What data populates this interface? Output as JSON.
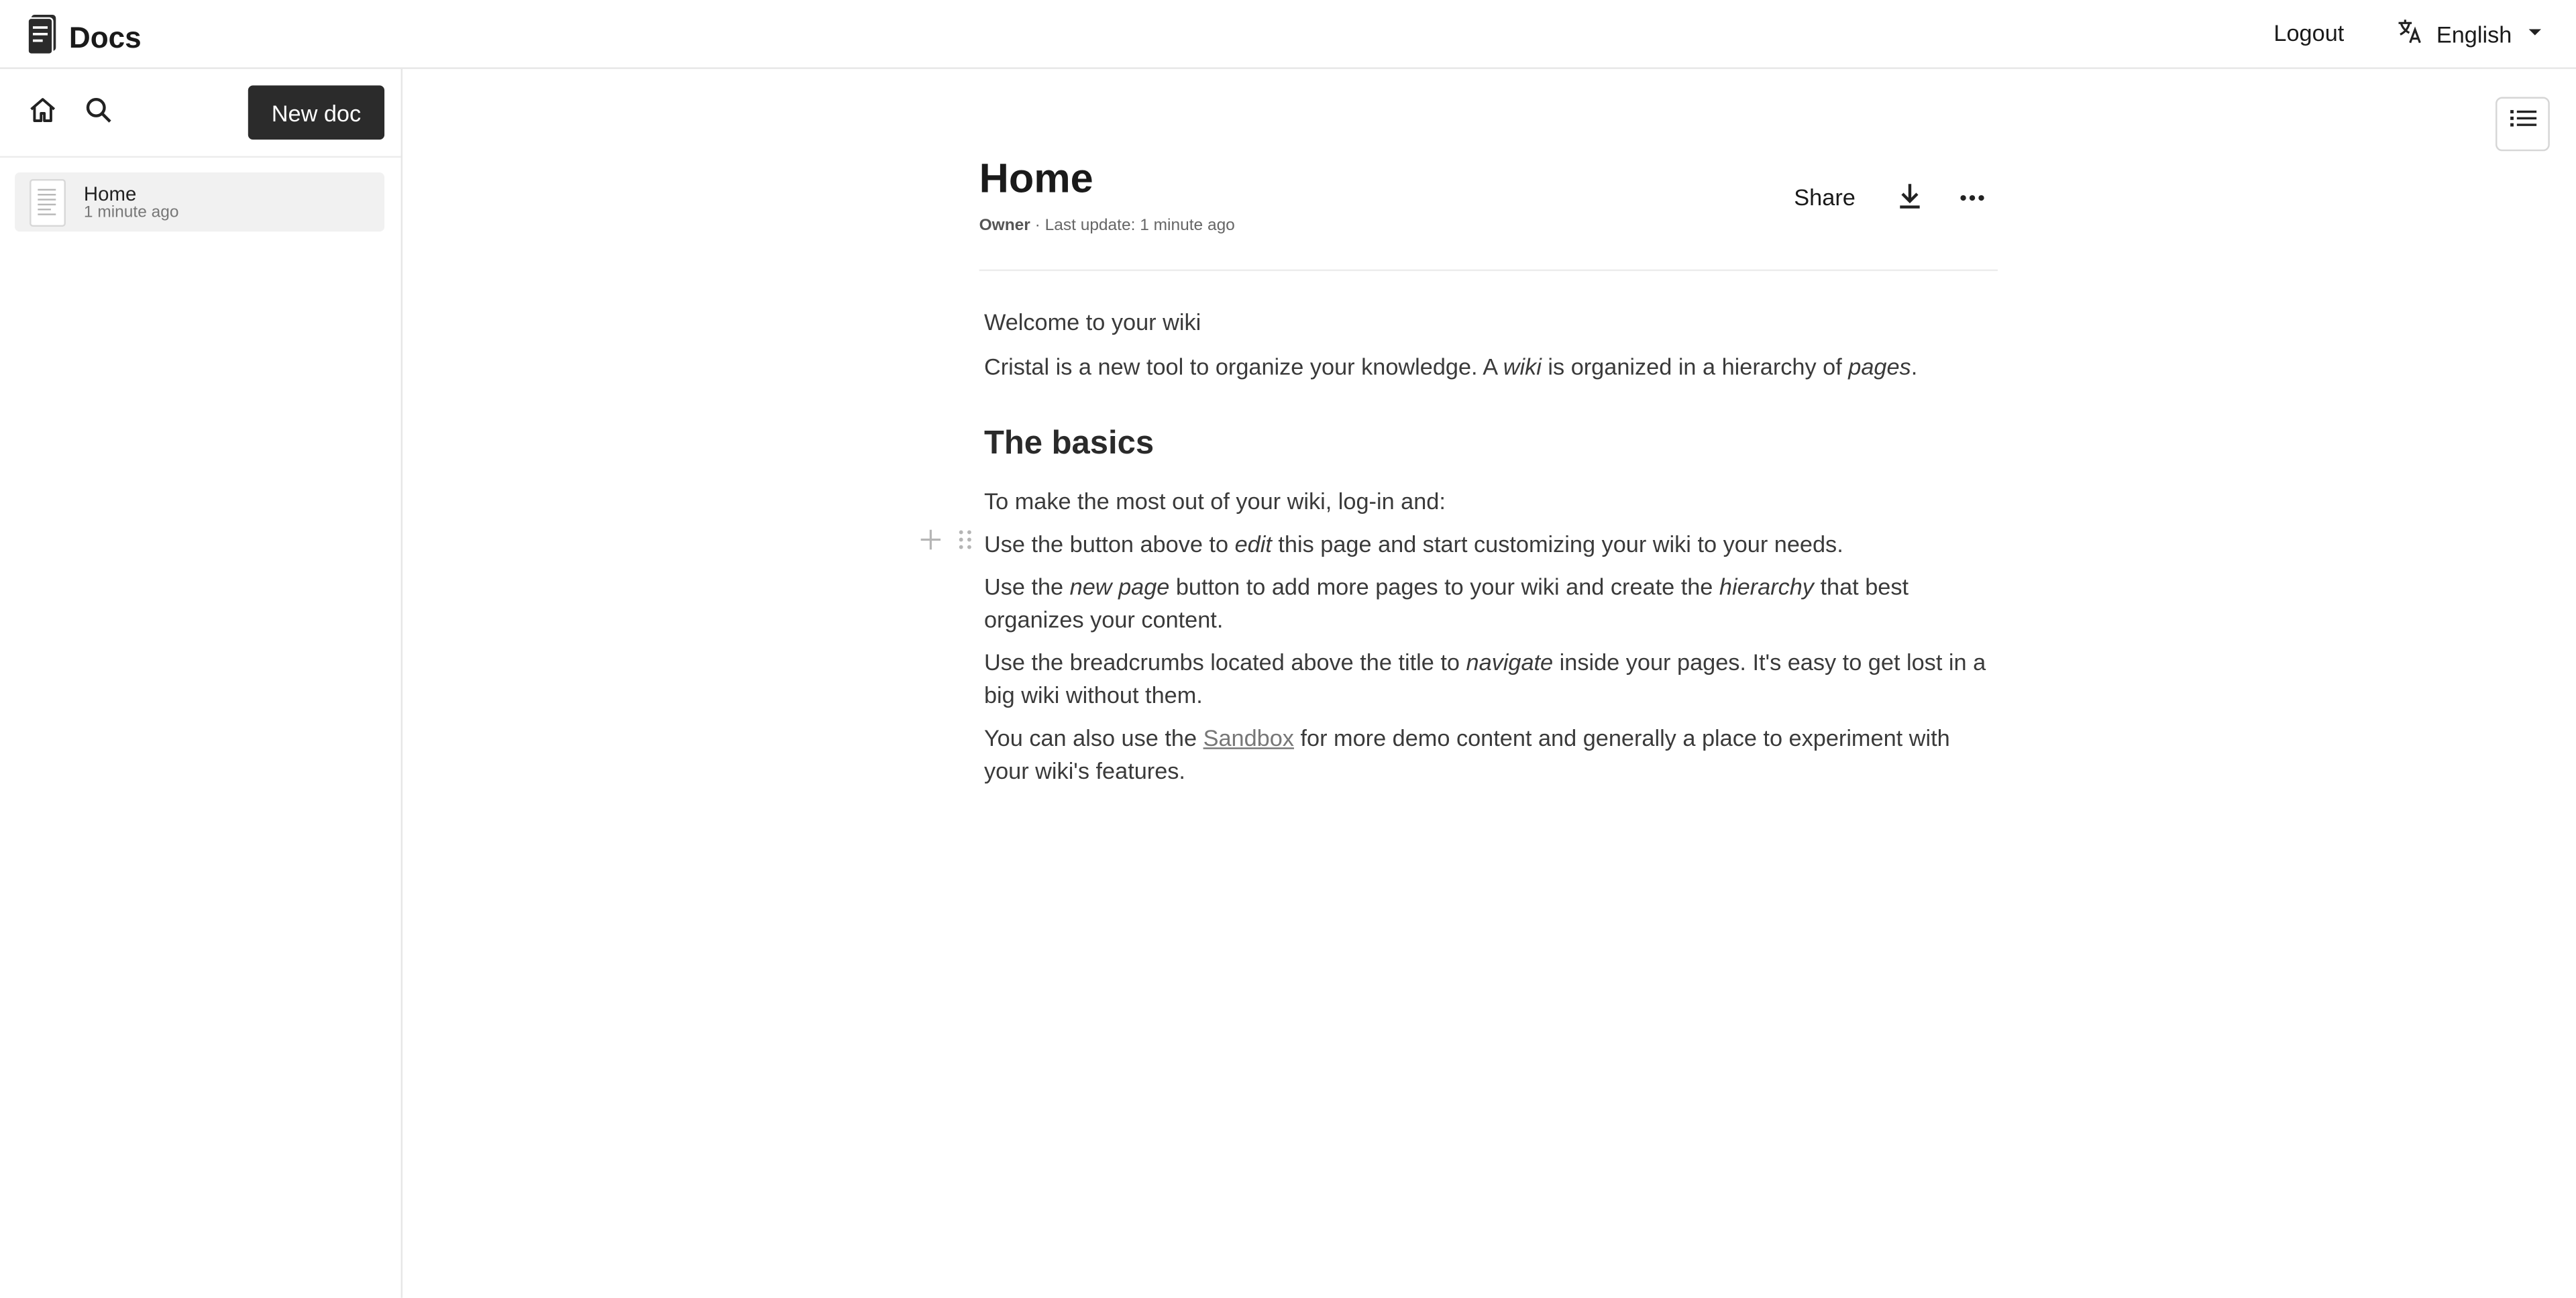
{
  "header": {
    "app_name": "Docs",
    "logout_label": "Logout",
    "language_label": "English"
  },
  "sidebar": {
    "new_doc_label": "New doc",
    "docs": [
      {
        "title": "Home",
        "time": "1 minute ago"
      }
    ]
  },
  "document": {
    "title": "Home",
    "role": "Owner",
    "meta_sep": " · ",
    "last_update": "Last update: 1 minute ago",
    "share_label": "Share"
  },
  "content": {
    "p1": "Welcome to your wiki",
    "p2": {
      "a": "Cristal is a new tool to organize your knowledge. A ",
      "b": "wiki",
      "c": " is organized in a hierarchy of ",
      "d": "pages",
      "e": "."
    },
    "heading": "The basics",
    "p3": "To make the most out of your wiki, log-in and:",
    "p4": {
      "a": "Use the button above to ",
      "b": "edit",
      "c": " this page and start customizing your wiki to your needs."
    },
    "p5": {
      "a": "Use the ",
      "b": "new page",
      "c": " button to add more pages to your wiki and create the ",
      "d": "hierarchy",
      "e": " that best organizes your content."
    },
    "p6": {
      "a": "Use the breadcrumbs located above the title to ",
      "b": "navigate",
      "c": " inside your pages. It's easy to get lost in a big wiki without them."
    },
    "p7": {
      "a": "You can also use the ",
      "link": "Sandbox",
      "c": " for more demo content and generally a place to experiment with your wiki's features."
    }
  },
  "icons": {
    "logo": "docs-logo-icon",
    "language": "translate-icon",
    "home": "home-icon",
    "search": "search-icon",
    "toc": "list-icon",
    "download": "download-icon",
    "more": "more-horizontal-icon"
  },
  "colors": {
    "primary_button": "#2b2b2b",
    "selected_item": "#f1f1f1",
    "link": "#777777"
  }
}
